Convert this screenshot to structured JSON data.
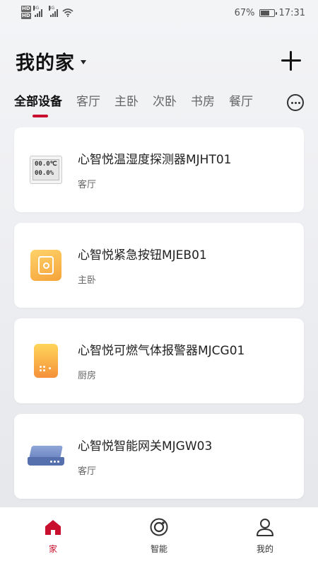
{
  "status_bar": {
    "hd1": "HD",
    "hd2": "HD",
    "net1": "4G",
    "net2": "4G",
    "battery_percent": "67%",
    "battery_level": 0.67,
    "time": "17:31"
  },
  "header": {
    "home_name": "我的家"
  },
  "tabs": [
    {
      "label": "全部设备",
      "active": true
    },
    {
      "label": "客厅"
    },
    {
      "label": "主卧"
    },
    {
      "label": "次卧"
    },
    {
      "label": "书房"
    },
    {
      "label": "餐厅"
    }
  ],
  "devices": [
    {
      "name": "心智悦温湿度探测器MJHT01",
      "room": "客厅",
      "icon": "thermo-hygrometer-icon",
      "screen_line1": "00.0℃",
      "screen_line2": "00.0%"
    },
    {
      "name": "心智悦紧急按钮MJEB01",
      "room": "主卧",
      "icon": "emergency-button-icon"
    },
    {
      "name": "心智悦可燃气体报警器MJCG01",
      "room": "厨房",
      "icon": "gas-alarm-icon"
    },
    {
      "name": "心智悦智能网关MJGW03",
      "room": "客厅",
      "icon": "gateway-icon"
    }
  ],
  "bottom_nav": [
    {
      "label": "家",
      "icon": "home-icon",
      "active": true
    },
    {
      "label": "智能",
      "icon": "smart-icon"
    },
    {
      "label": "我的",
      "icon": "profile-icon"
    }
  ],
  "colors": {
    "accent": "#c8102e",
    "icon_orange": "#f5a33a",
    "icon_blue": "#6d86c2"
  }
}
